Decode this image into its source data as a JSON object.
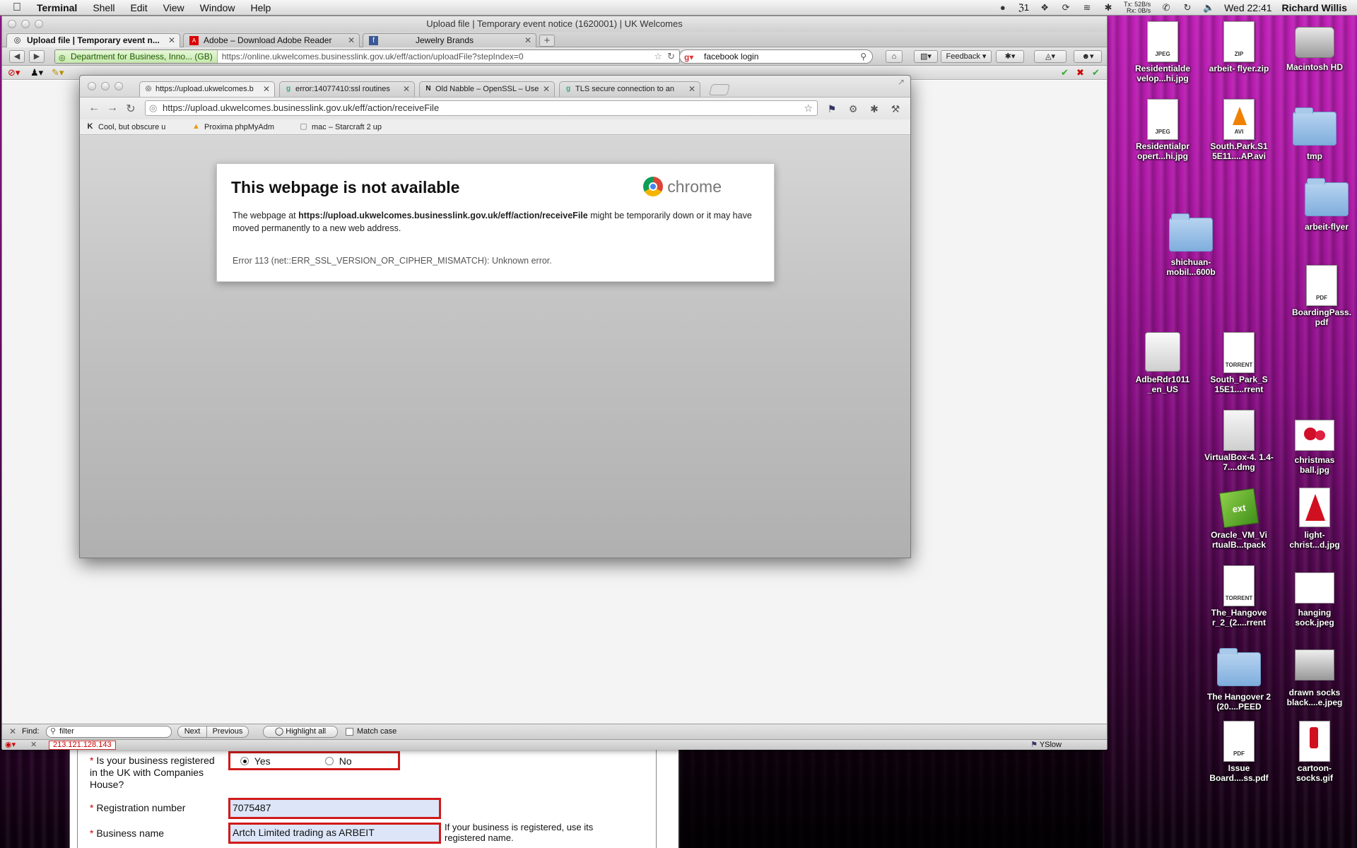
{
  "menubar": {
    "app": "Terminal",
    "menus": [
      "Shell",
      "Edit",
      "View",
      "Window",
      "Help"
    ],
    "adobe_count": "1",
    "net_up": "52B/s",
    "net_down": "0B/s",
    "net_tx": "Tx:",
    "net_rx": "Rx:",
    "clock": "Wed 22:41",
    "user": "Richard Willis"
  },
  "firefox": {
    "window_title": "Upload file | Temporary event notice (1620001) | UK Welcomes",
    "tabs": [
      {
        "label": "Upload file | Temporary event n..."
      },
      {
        "label": "Adobe – Download Adobe Reader"
      },
      {
        "label": "Jewelry Brands"
      }
    ],
    "identity": "Department for Business, Inno... (GB)",
    "url": "https://online.ukwelcomes.businesslink.gov.uk/eff/action/uploadFile?stepIndex=0",
    "search_value": "facebook login",
    "feedback_label": "Feedback",
    "find": {
      "label": "Find:",
      "value": "filter",
      "next": "Next",
      "previous": "Previous",
      "highlight_all": "Highlight all",
      "match_case": "Match case"
    },
    "status": {
      "ip": "213.121.128.143",
      "yslow": "YSlow"
    }
  },
  "chrome": {
    "tabs": [
      {
        "label": "https://upload.ukwelcomes.b"
      },
      {
        "label": "error:14077410:ssl routines"
      },
      {
        "label": "Old Nabble – OpenSSL – Use"
      },
      {
        "label": "TLS secure connection to an"
      }
    ],
    "url": "https://upload.ukwelcomes.businesslink.gov.uk/eff/action/receiveFile",
    "bookmarks": [
      {
        "label": "Cool, but obscure u"
      },
      {
        "label": "Proxima phpMyAdm"
      },
      {
        "label": "mac – Starcraft 2 up"
      }
    ],
    "error": {
      "title": "This webpage is not available",
      "brand": "chrome",
      "msg_pre": "The webpage at ",
      "msg_url": "https://upload.ukwelcomes.businesslink.gov.uk/eff/action/receiveFile",
      "msg_post": " might be temporarily down or it may have moved permanently to a new web address.",
      "code": "Error 113 (net::ERR_SSL_VERSION_OR_CIPHER_MISMATCH): Unknown error."
    }
  },
  "form": {
    "q_registered_line1": "Is your business registered",
    "q_registered_line2": "in the UK with Companies",
    "q_registered_line3": "House?",
    "yes": "Yes",
    "no": "No",
    "reg_label": "Registration number",
    "reg_value": "7075487",
    "name_label": "Business name",
    "name_value": "Artch Limited trading as ARBEIT",
    "hint_line1": "If your business is registered, use its",
    "hint_line2": "registered name."
  },
  "desktop_icons": [
    {
      "label": "Residentialde velop...hi.jpg",
      "tag": "JPEG"
    },
    {
      "label": "arbeit- flyer.zip",
      "tag": "ZIP"
    },
    {
      "label": "Macintosh HD"
    },
    {
      "label": "Residentialpr opert...hi.jpg",
      "tag": "JPEG"
    },
    {
      "label": "South.Park.S1 5E11....AP.avi",
      "tag": "AVI"
    },
    {
      "label": "tmp"
    },
    {
      "label": "shichuan- mobil...600b"
    },
    {
      "label": "arbeit-flyer"
    },
    {
      "label": "BoardingPass. pdf",
      "tag": "PDF"
    },
    {
      "label": "AdbeRdr1011 _en_US"
    },
    {
      "label": "South_Park_S 15E1....rrent",
      "tag": "TORRENT"
    },
    {
      "label": "VirtualBox-4. 1.4-7....dmg"
    },
    {
      "label": "christmas ball.jpg"
    },
    {
      "label": "Oracle_VM_Vi rtualB...tpack",
      "tag": "ext"
    },
    {
      "label": "light- christ...d.jpg"
    },
    {
      "label": "The_Hangove r_2_(2....rrent",
      "tag": "TORRENT"
    },
    {
      "label": "hanging sock.jpeg"
    },
    {
      "label": "The Hangover 2 (20....PEED"
    },
    {
      "label": "drawn socks black....e.jpeg"
    },
    {
      "label": "Issue Board....ss.pdf",
      "tag": "PDF"
    },
    {
      "label": "cartoon- socks.gif"
    }
  ],
  "colors": {
    "error_red": "#d01a1a",
    "identity_green": "#1c5a00",
    "desktop_magenta": "#b01aa8"
  }
}
